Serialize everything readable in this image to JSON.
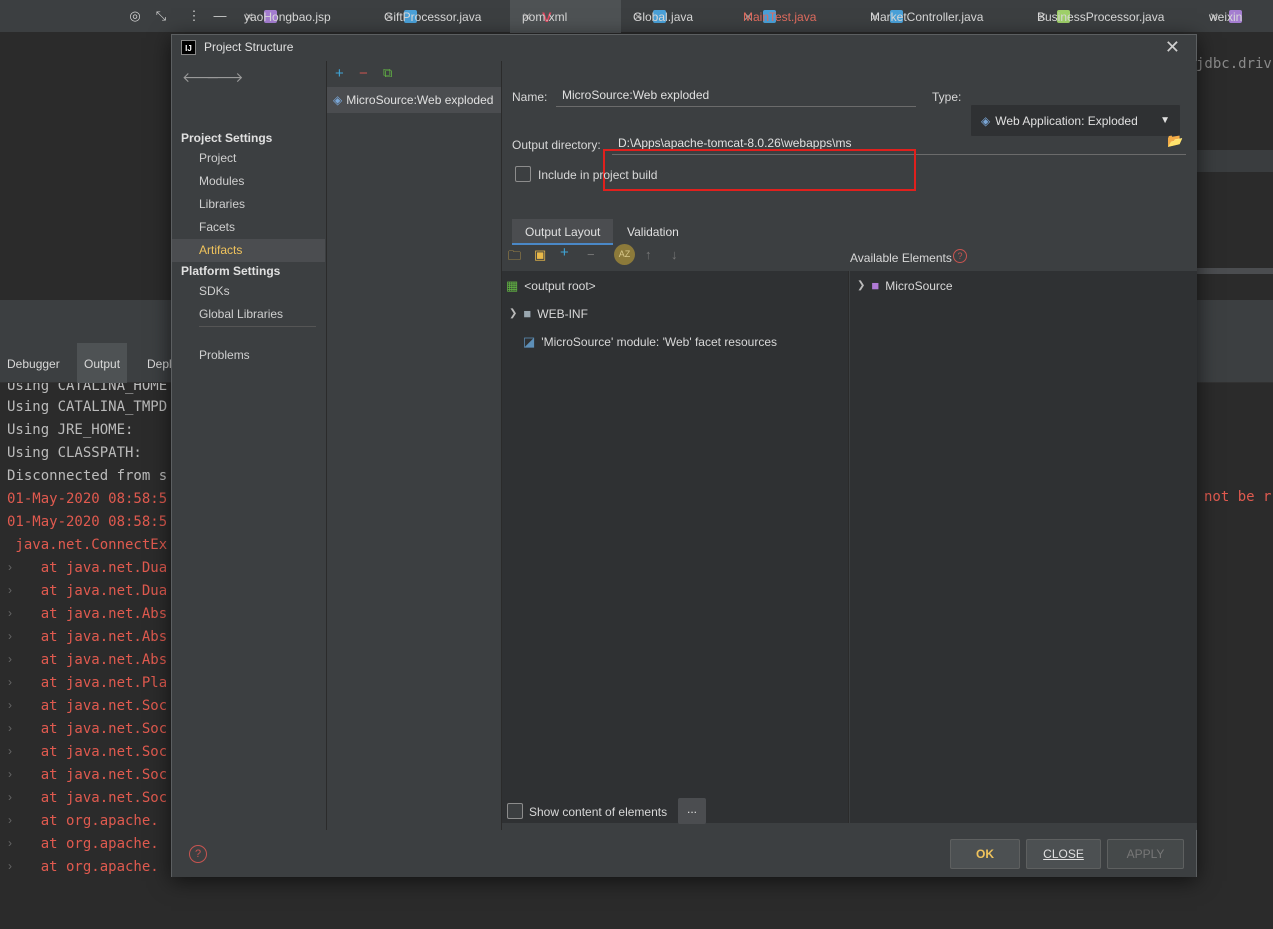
{
  "editor_tabs": [
    {
      "label": "yaoHongbao.jsp",
      "color": "#a47dd0"
    },
    {
      "label": "GiftProcessor.java",
      "color": "#4aa0d8"
    },
    {
      "label": "pom.xml",
      "color": "#e0475f"
    },
    {
      "label": "Global.java",
      "color": "#4aa0d8"
    },
    {
      "label": "MainTest.java",
      "color": "#4aa0d8"
    },
    {
      "label": "MarketController.java",
      "color": "#4aa0d8"
    },
    {
      "label": "BusinessProcessor.java",
      "color": "#9fd06a"
    },
    {
      "label": "weixin",
      "color": "#a47dd0"
    }
  ],
  "background": {
    "code_right": "jdbc.driv",
    "run_tabs": [
      "Debugger",
      "Output",
      "Depl"
    ],
    "console_lines": [
      {
        "text": "Using CATALINA_HOME",
        "style": "gray"
      },
      {
        "text": "Using CATALINA_TMPD",
        "style": "gray"
      },
      {
        "text": "Using JRE_HOME:",
        "style": "gray"
      },
      {
        "text": "Using CLASSPATH:",
        "style": "gray"
      },
      {
        "text": "Disconnected from s",
        "style": "gray"
      },
      {
        "text": "01-May-2020 08:58:5",
        "style": "red"
      },
      {
        "text": "01-May-2020 08:58:5",
        "style": "red"
      },
      {
        "text": " java.net.ConnectEx",
        "style": "red"
      },
      {
        "text": "    at java.net.Dua",
        "style": "red"
      },
      {
        "text": "    at java.net.Dua",
        "style": "red"
      },
      {
        "text": "    at java.net.Abs",
        "style": "red"
      },
      {
        "text": "    at java.net.Abs",
        "style": "red"
      },
      {
        "text": "    at java.net.Abs",
        "style": "red"
      },
      {
        "text": "    at java.net.Pla",
        "style": "red"
      },
      {
        "text": "    at java.net.Soc",
        "style": "red"
      },
      {
        "text": "    at java.net.Soc",
        "style": "red"
      },
      {
        "text": "    at java.net.Soc",
        "style": "red"
      },
      {
        "text": "    at java.net.Soc",
        "style": "red"
      },
      {
        "text": "    at java.net.Soc",
        "style": "red"
      },
      {
        "text": "    at org.apache.",
        "style": "red"
      },
      {
        "text": "    at org.apache.",
        "style": "red"
      },
      {
        "text": "    at org.apache.",
        "style": "red"
      }
    ],
    "console_right": "not be r"
  },
  "dialog": {
    "title": "Project Structure",
    "logo_text": "IJ",
    "nav": {
      "project_settings_label": "Project Settings",
      "project_items": [
        "Project",
        "Modules",
        "Libraries",
        "Facets",
        "Artifacts"
      ],
      "platform_settings_label": "Platform Settings",
      "platform_items": [
        "SDKs",
        "Global Libraries"
      ],
      "problems": "Problems",
      "selected": "Artifacts"
    },
    "artifact_list": [
      "MicroSource:Web exploded"
    ],
    "name_label": "Name:",
    "name_value": "MicroSource:Web exploded",
    "type_label": "Type:",
    "type_value": "Web Application: Exploded",
    "output_dir_label": "Output directory:",
    "output_dir_value": "D:\\Apps\\apache-tomcat-8.0.26\\webapps\\ms",
    "include_build_label": "Include in project build",
    "include_build_checked": false,
    "subtabs": [
      "Output Layout",
      "Validation"
    ],
    "active_subtab": "Output Layout",
    "available_label": "Available Elements",
    "layout_tree": [
      {
        "label": "<output root>",
        "icon": "output-root-icon"
      },
      {
        "label": "WEB-INF",
        "icon": "folder-icon"
      },
      {
        "label": "'MicroSource' module: 'Web' facet resources",
        "icon": "web-facet-icon"
      }
    ],
    "available_tree": [
      {
        "label": "MicroSource",
        "icon": "module-folder-icon"
      }
    ],
    "show_content_label": "Show content of elements",
    "show_content_checked": false,
    "dots_button": "...",
    "ok_button": "OK",
    "close_button": "CLOSE",
    "apply_button": "APPLY",
    "accent_color": "#f0c35c",
    "highlight_color": "#e0201d"
  }
}
